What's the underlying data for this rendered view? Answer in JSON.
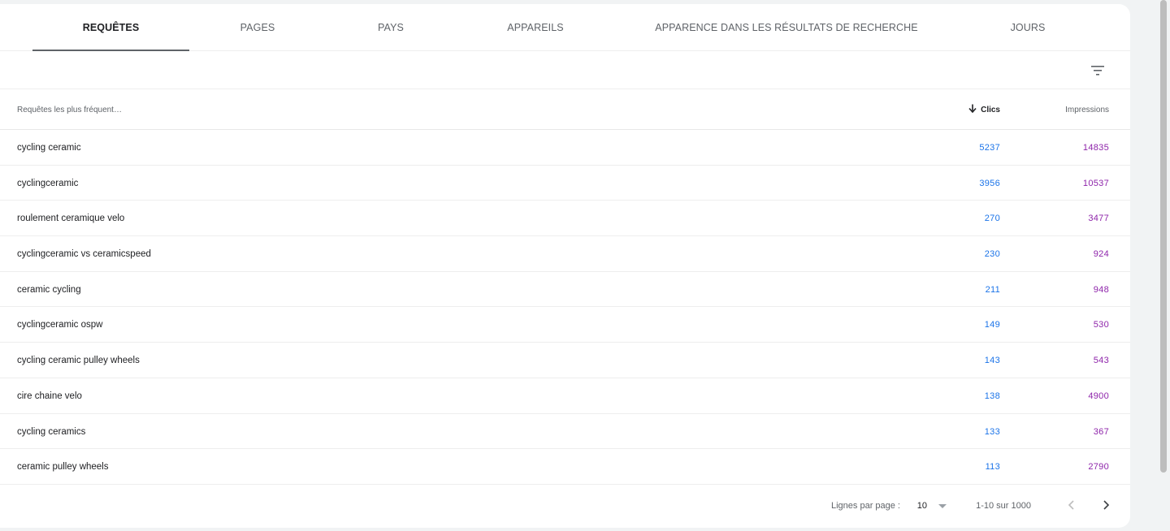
{
  "tabs": [
    {
      "label": "REQUÊTES",
      "active": true
    },
    {
      "label": "PAGES",
      "active": false
    },
    {
      "label": "PAYS",
      "active": false
    },
    {
      "label": "APPAREILS",
      "active": false
    },
    {
      "label": "APPARENCE DANS LES RÉSULTATS DE RECHERCHE",
      "active": false
    },
    {
      "label": "JOURS",
      "active": false
    }
  ],
  "filter_icon": "filter-icon",
  "table": {
    "headers": {
      "query": "Requêtes les plus fréquent…",
      "clicks": "Clics",
      "impressions": "Impressions"
    },
    "sort_icon": "arrow-down-icon",
    "rows": [
      {
        "query": "cycling ceramic",
        "clicks": "5237",
        "impressions": "14835"
      },
      {
        "query": "cyclingceramic",
        "clicks": "3956",
        "impressions": "10537"
      },
      {
        "query": "roulement ceramique velo",
        "clicks": "270",
        "impressions": "3477"
      },
      {
        "query": "cyclingceramic vs ceramicspeed",
        "clicks": "230",
        "impressions": "924"
      },
      {
        "query": "ceramic cycling",
        "clicks": "211",
        "impressions": "948"
      },
      {
        "query": "cyclingceramic ospw",
        "clicks": "149",
        "impressions": "530"
      },
      {
        "query": "cycling ceramic pulley wheels",
        "clicks": "143",
        "impressions": "543"
      },
      {
        "query": "cire chaine velo",
        "clicks": "138",
        "impressions": "4900"
      },
      {
        "query": "cycling ceramics",
        "clicks": "133",
        "impressions": "367"
      },
      {
        "query": "ceramic pulley wheels",
        "clicks": "113",
        "impressions": "2790"
      }
    ]
  },
  "footer": {
    "rows_per_page_label": "Lignes par page :",
    "rows_per_page_value": "10",
    "range": "1-10 sur 1000"
  },
  "colors": {
    "clicks": "#1a73e8",
    "impressions": "#8e24aa"
  }
}
